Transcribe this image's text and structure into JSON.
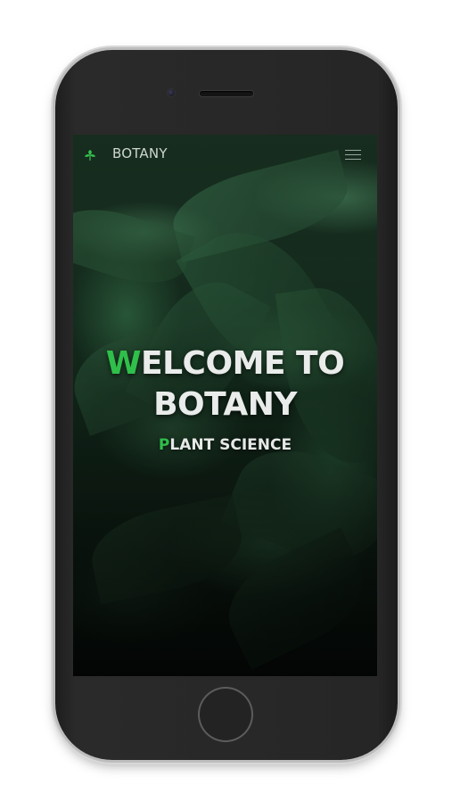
{
  "navbar": {
    "brand_icon": "leaf-plant-icon",
    "brand_name": "BOTANY",
    "menu_icon": "hamburger-menu-icon"
  },
  "hero": {
    "title_first_letter": "W",
    "title_line1_rest": "ELCOME TO",
    "title_line2": "BOTANY",
    "subtitle_first_letter": "P",
    "subtitle_rest": "LANT SCIENCE"
  },
  "colors": {
    "accent": "#2fbf4a",
    "hero_text": "#e9ecea",
    "nav_text": "#cfd6d1",
    "phone_body": "#262626"
  }
}
